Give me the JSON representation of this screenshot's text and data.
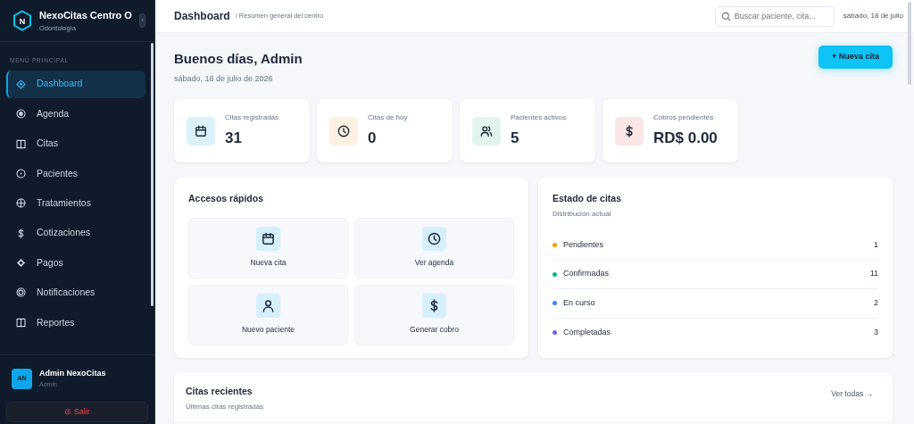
{
  "sidebar": {
    "brand": {
      "logo_letter": "N",
      "title": "NexoCitas Centro O",
      "subtitle": "Odontología",
      "collapse": "‹"
    },
    "section_label": "MENÚ PRINCIPAL",
    "items": [
      {
        "label": "Dashboard",
        "selected": true
      },
      {
        "label": "Agenda",
        "selected": false
      },
      {
        "label": "Citas",
        "selected": false
      },
      {
        "label": "Pacientes",
        "selected": false
      },
      {
        "label": "Tratamientos",
        "selected": false
      },
      {
        "label": "Cotizaciones",
        "selected": false
      },
      {
        "label": "Pagos",
        "selected": false
      },
      {
        "label": "Notificaciones",
        "selected": false
      },
      {
        "label": "Reportes",
        "selected": false
      }
    ],
    "user": {
      "initials": "AN",
      "name": "Admin NexoCitas",
      "role": "Admin"
    },
    "logout": {
      "icon": "⊘",
      "label": "Salir"
    }
  },
  "header": {
    "title": "Dashboard",
    "breadcrumb": "/ Resumen general del centro",
    "search": {
      "placeholder": "Buscar paciente, cita..."
    },
    "date": "sábado, 18 de julio"
  },
  "greeting": {
    "title": "Buenos días, Admin",
    "date": "sábado, 18 de julio de 2026",
    "button": "+ Nueva cita"
  },
  "stats": [
    {
      "label": "Citas registradas",
      "value": "31"
    },
    {
      "label": "Citas de hoy",
      "value": "0"
    },
    {
      "label": "Pacientes activos",
      "value": "5"
    },
    {
      "label": "Cobros pendientes",
      "value": "RD$ 0.00"
    }
  ],
  "quick_access": {
    "title": "Accesos rápidos",
    "items": [
      {
        "label": "Nueva cita"
      },
      {
        "label": "Ver agenda"
      },
      {
        "label": "Nuevo paciente"
      },
      {
        "label": "Generar cobro"
      }
    ]
  },
  "status": {
    "title": "Estado de citas",
    "subtitle": "Distribución actual",
    "items": [
      {
        "label": "Pendientes",
        "count": "1",
        "color": "#f59e0b"
      },
      {
        "label": "Confirmadas",
        "count": "11",
        "color": "#10b981"
      },
      {
        "label": "En curso",
        "count": "2",
        "color": "#3b82f6"
      },
      {
        "label": "Completadas",
        "count": "3",
        "color": "#6366f1"
      }
    ]
  },
  "recent": {
    "title": "Citas recientes",
    "subtitle": "Últimas citas registradas",
    "link": "Ver todas →"
  }
}
